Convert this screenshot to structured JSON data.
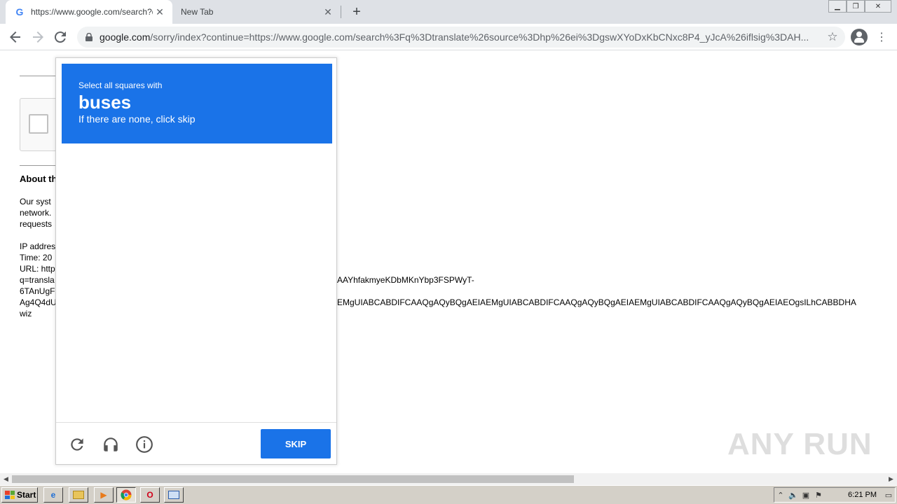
{
  "browser": {
    "tabs": [
      {
        "title": "https://www.google.com/search?q=",
        "favicon": "G"
      },
      {
        "title": "New Tab"
      }
    ],
    "url_host": "google.com",
    "url_rest": "/sorry/index?continue=https://www.google.com/search%3Fq%3Dtranslate%26source%3Dhp%26ei%3DgswXYoDxKbCNxc8P4_yJcA%26iflsig%3DAH...",
    "window_controls": [
      "minimize",
      "restore",
      "close"
    ]
  },
  "page": {
    "about_heading": "About th",
    "body_lines": [
      "Our syst",
      "network.",
      "requests"
    ],
    "ip_lines": [
      "IP addres",
      "Time: 20",
      "URL: http",
      "q=transla",
      "6TAnUgF",
      "Ag4Q4dU",
      "wiz"
    ],
    "continuation_1": "AAYhfakmyeKDbMKnYbp3FSPWyT-",
    "continuation_2": "EMgUIABCABDIFCAAQgAQyBQgAEIAEMgUIABCABDIFCAAQgAQyBQgAEIAEMgUIABCABDIFCAAQgAQyBQgAEIAEOgsILhCABBDHA"
  },
  "captcha": {
    "instruction_line1": "Select all squares with",
    "target_word": "buses",
    "instruction_line3": "If there are none, click skip",
    "grid_size": 4,
    "skip_label": "SKIP",
    "icons": [
      "reload-icon",
      "audio-icon",
      "info-icon"
    ]
  },
  "watermark": "ANY RUN",
  "taskbar": {
    "start_label": "Start",
    "clock": "6:21 PM"
  }
}
